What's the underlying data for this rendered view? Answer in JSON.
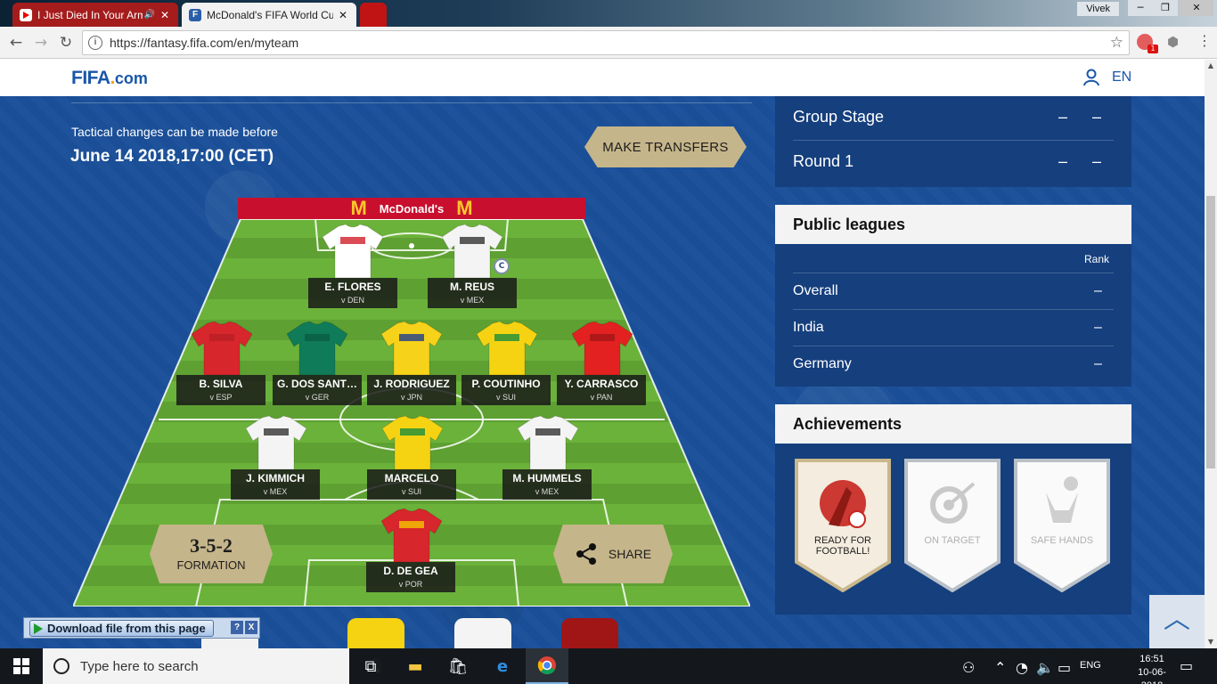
{
  "browser": {
    "tabs": [
      {
        "title": "I Just Died In Your Arms",
        "favicon_color": "#ff0000"
      },
      {
        "title": "McDonald's FIFA World Cup",
        "favicon_color": "#2a5ea8"
      }
    ],
    "user": "Vivek",
    "url": "https://fantasy.fifa.com/en/myteam",
    "extension_badge": "1"
  },
  "site": {
    "logo_main": "FIFA",
    "logo_dot": ".",
    "logo_tld": "com",
    "language": "EN"
  },
  "team": {
    "tactical_note": "Tactical changes can be made before",
    "deadline": "June 14 2018,17:00 (CET)",
    "make_transfers": "MAKE TRANSFERS",
    "sponsor": "McDonald's",
    "sponsor_logo": "M",
    "formation_value": "3-5-2",
    "formation_label": "FORMATION",
    "share_label": "SHARE",
    "captain_mark": "C",
    "players": [
      {
        "name": "E. FLORES",
        "opp": "v DEN",
        "shirt": "#ffffff",
        "stripe": "#d21f2a"
      },
      {
        "name": "M. REUS",
        "opp": "v MEX",
        "shirt": "#f4f4f4",
        "stripe": "#333333"
      },
      {
        "name": "B. SILVA",
        "opp": "v ESP",
        "shirt": "#d7262c",
        "stripe": "#b81f25"
      },
      {
        "name": "G. DOS SANT…",
        "opp": "v GER",
        "shirt": "#0f7b58",
        "stripe": "#0a5e42"
      },
      {
        "name": "J. RODRIGUEZ",
        "opp": "v JPN",
        "shirt": "#f7d21a",
        "stripe": "#1f3c8c"
      },
      {
        "name": "P. COUTINHO",
        "opp": "v SUI",
        "shirt": "#f6d312",
        "stripe": "#1a8d3b"
      },
      {
        "name": "Y. CARRASCO",
        "opp": "v PAN",
        "shirt": "#e32121",
        "stripe": "#a01616"
      },
      {
        "name": "J. KIMMICH",
        "opp": "v MEX",
        "shirt": "#f4f4f4",
        "stripe": "#333333"
      },
      {
        "name": "MARCELO",
        "opp": "v SUI",
        "shirt": "#f6d312",
        "stripe": "#1a8d3b"
      },
      {
        "name": "M. HUMMELS",
        "opp": "v MEX",
        "shirt": "#f4f4f4",
        "stripe": "#333333"
      },
      {
        "name": "D. DE GEA",
        "opp": "v POR",
        "shirt": "#d7262c",
        "stripe": "#f5c400"
      }
    ]
  },
  "stages": [
    {
      "name": "Group Stage",
      "points": "–",
      "rank": "–"
    },
    {
      "name": "Round 1",
      "points": "–",
      "rank": "–"
    }
  ],
  "leagues": {
    "title": "Public leagues",
    "rank_header": "Rank",
    "rows": [
      {
        "name": "Overall",
        "rank": "–"
      },
      {
        "name": "India",
        "rank": "–"
      },
      {
        "name": "Germany",
        "rank": "–"
      }
    ]
  },
  "achievements": {
    "title": "Achievements",
    "items": [
      {
        "label": "READY FOR FOOTBALL!",
        "unlocked": true
      },
      {
        "label": "ON TARGET",
        "unlocked": false
      },
      {
        "label": "SAFE HANDS",
        "unlocked": false
      }
    ]
  },
  "download_bar": {
    "label": "Download file from this page",
    "help": "?",
    "close": "X"
  },
  "taskbar": {
    "search_placeholder": "Type here to search",
    "language": "ENG",
    "time": "16:51",
    "date": "10-06-2018"
  }
}
